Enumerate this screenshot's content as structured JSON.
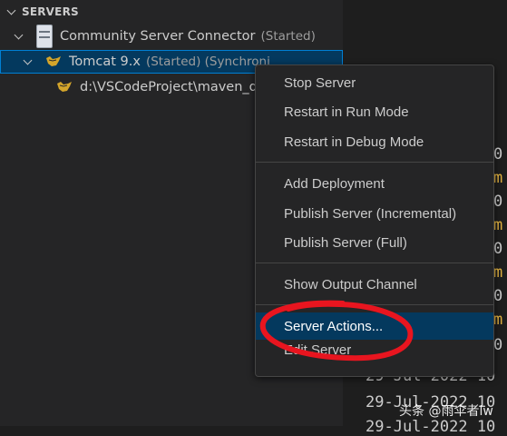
{
  "explorer": {
    "section_title": "SERVERS",
    "connector": {
      "label": "Community Server Connector",
      "status": "(Started)"
    },
    "server": {
      "label": "Tomcat 9.x",
      "status": "(Started) (Synchroni"
    },
    "deployment": {
      "label": "d:\\VSCodeProject\\maven_d"
    }
  },
  "context_menu": {
    "groups": [
      [
        "Stop Server",
        "Restart in Run Mode",
        "Restart in Debug Mode"
      ],
      [
        "Add Deployment",
        "Publish Server (Incremental)",
        "Publish Server (Full)"
      ],
      [
        "Show Output Channel"
      ],
      [
        "Server Actions...",
        "Edit Server"
      ]
    ],
    "selected": "Server Actions..."
  },
  "terminal": {
    "lines": [
      "29-Jul-2022 10",
      "29-Jul-2022 10",
      "29-Jul-2022 10"
    ]
  },
  "watermark": "头条 @雨伞者lw",
  "colors": {
    "selection": "#04395e",
    "focus_border": "#007fd4",
    "marker": "#e8151f"
  }
}
